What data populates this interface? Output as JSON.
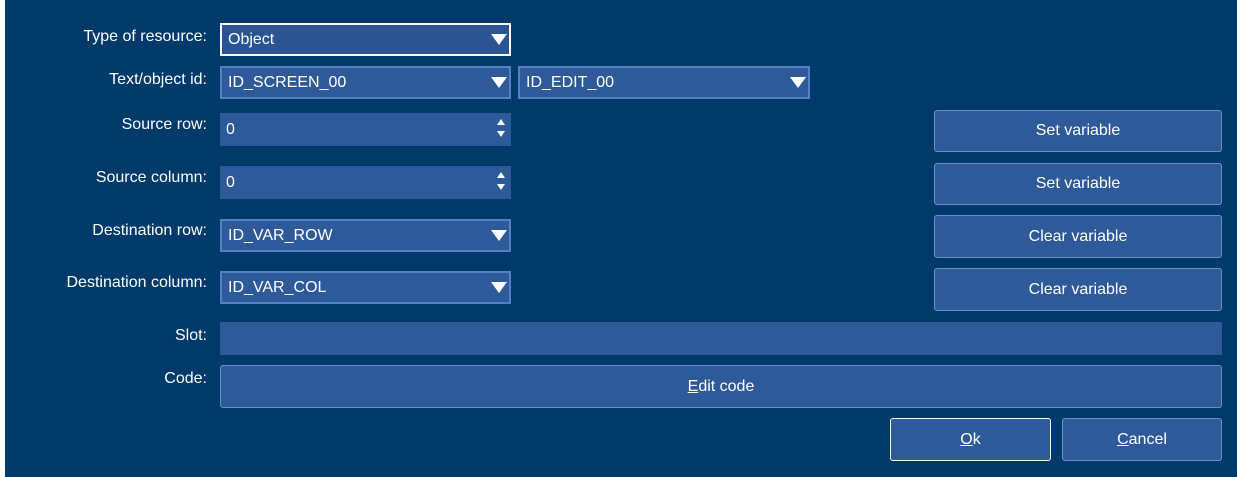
{
  "labels": {
    "type_of_resource": "Type of resource:",
    "text_object_id": "Text/object id:",
    "source_row": "Source row:",
    "source_column": "Source column:",
    "destination_row": "Destination row:",
    "destination_column": "Destination column:",
    "slot": "Slot:",
    "code": "Code:"
  },
  "fields": {
    "type_of_resource": "Object",
    "text_id": "ID_SCREEN_00",
    "object_id": "ID_EDIT_00",
    "source_row": "0",
    "source_column": "0",
    "destination_row": "ID_VAR_ROW",
    "destination_column": "ID_VAR_COL",
    "slot": ""
  },
  "buttons": {
    "set_variable_row": "Set variable",
    "set_variable_col": "Set variable",
    "clear_variable_row": "Clear variable",
    "clear_variable_col": "Clear variable",
    "edit_code_mnemonic": "E",
    "edit_code_rest": "dit code",
    "ok_mnemonic": "O",
    "ok_rest": "k",
    "cancel_mnemonic": "C",
    "cancel_rest": "ancel"
  },
  "colors": {
    "background": "#003a6b",
    "field": "#2f5a9a",
    "field_border": "#5581c4"
  }
}
